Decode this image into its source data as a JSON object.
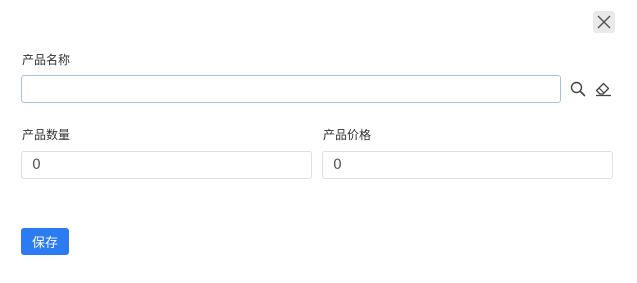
{
  "form": {
    "product_name_label": "产品名称",
    "product_name_value": "",
    "product_qty_label": "产品数量",
    "product_qty_value": "0",
    "product_price_label": "产品价格",
    "product_price_value": "0",
    "save_label": "保存"
  },
  "icons": {
    "close": "close-icon",
    "search": "search-icon",
    "clear": "eraser-icon"
  },
  "colors": {
    "primary": "#2b7cf0",
    "close_bg": "#e9e9e9",
    "border": "#dcdfe6",
    "focused_border": "#a9c3d6"
  }
}
